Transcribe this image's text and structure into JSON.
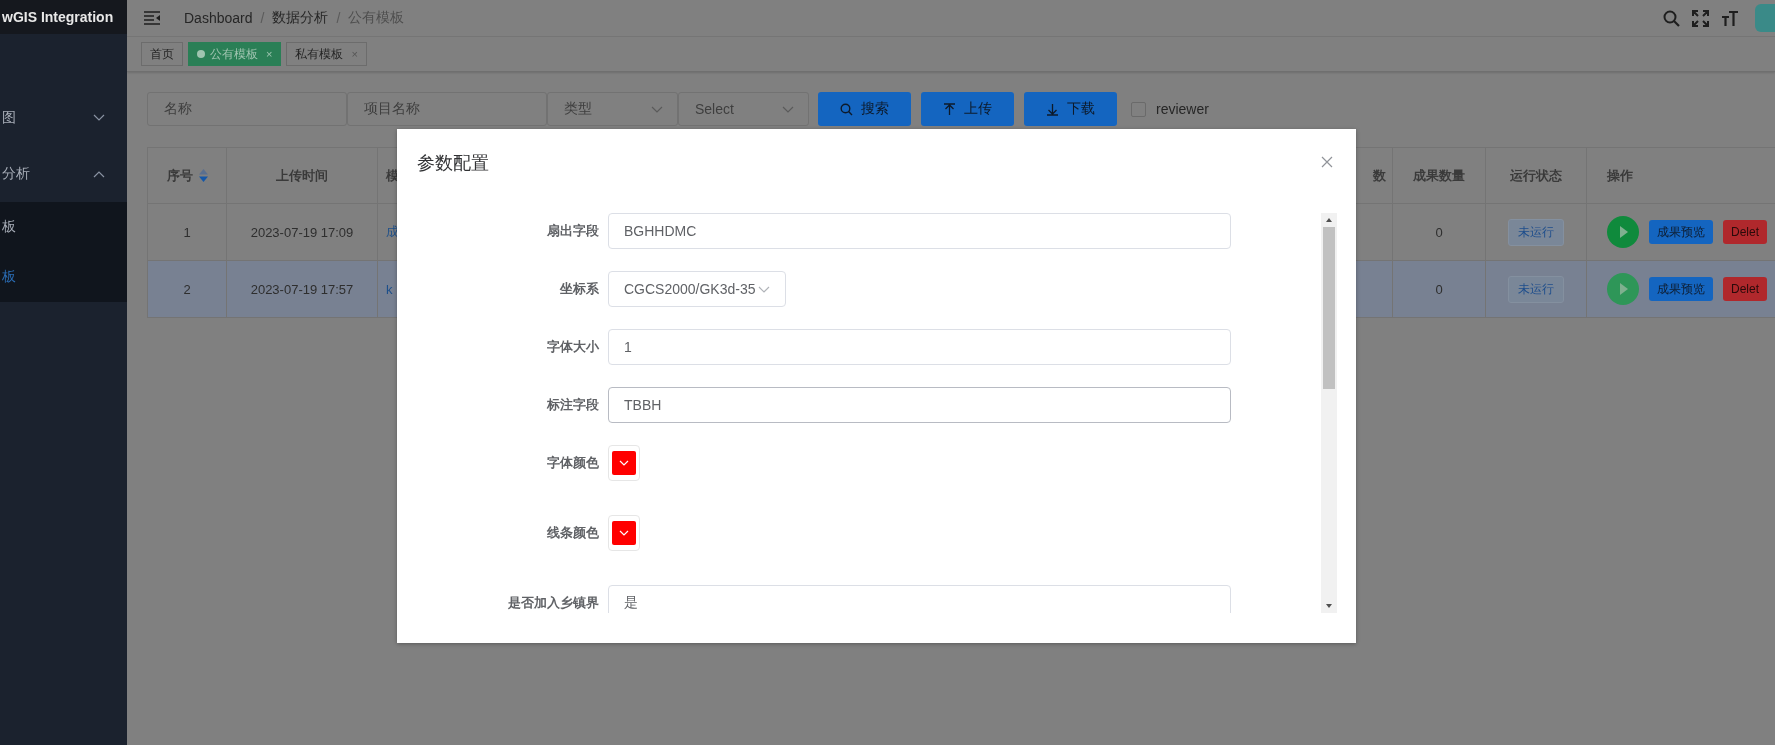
{
  "sidebar": {
    "title": "wGIS Integration",
    "items": [
      {
        "label": "图",
        "expanded": false
      },
      {
        "label": "分析",
        "expanded": true,
        "children": [
          {
            "label": "板",
            "selected": false
          },
          {
            "label": "板",
            "selected": true
          }
        ]
      }
    ]
  },
  "header": {
    "breadcrumb": [
      {
        "label": "Dashboard",
        "current": false
      },
      {
        "label": "数据分析",
        "current": false
      },
      {
        "label": "公有模板",
        "current": true
      }
    ],
    "separator": "/"
  },
  "tags": [
    {
      "label": "首页",
      "selected": false
    },
    {
      "label": "公有模板",
      "selected": true,
      "close": "×"
    },
    {
      "label": "私有模板",
      "selected": false,
      "close": "×"
    }
  ],
  "filters": [
    {
      "kind": "input",
      "placeholder": "名称"
    },
    {
      "kind": "input",
      "placeholder": "项目名称"
    },
    {
      "kind": "select",
      "placeholder": "类型"
    },
    {
      "kind": "select",
      "placeholder": "Select"
    }
  ],
  "buttons": [
    {
      "label": "搜索",
      "kind": "search"
    },
    {
      "label": "上传",
      "kind": "upload"
    },
    {
      "label": "下载",
      "kind": "download"
    }
  ],
  "checkbox": {
    "label": "reviewer",
    "checked": false
  },
  "table": {
    "columns": [
      {
        "label": "序号",
        "sortable": true
      },
      {
        "label": "上传时间"
      },
      {
        "label": "模"
      },
      {
        "label": "数"
      },
      {
        "label": "成果数量"
      },
      {
        "label": "运行状态"
      },
      {
        "label": "操作"
      }
    ],
    "rows": [
      {
        "selected": false,
        "index": "1",
        "time": "2023-07-19 17:09",
        "column_3": "成",
        "count": "0",
        "status": "未运行",
        "preview": "成果预览",
        "delete": "Delet"
      },
      {
        "selected": true,
        "index": "2",
        "time": "2023-07-19 17:57",
        "column_3": "k",
        "count": "0",
        "status": "未运行",
        "preview": "成果预览",
        "delete": "Delet"
      }
    ]
  },
  "dialog": {
    "title": "参数配置",
    "fields": [
      {
        "label": "扇出字段",
        "kind": "input",
        "value": "BGHHDMC",
        "focused": false
      },
      {
        "label": "坐标系",
        "kind": "select",
        "value": "CGCS2000/GK3d-35"
      },
      {
        "label": "字体大小",
        "kind": "input",
        "value": "1",
        "focused": false
      },
      {
        "label": "标注字段",
        "kind": "input",
        "value": "TBBH",
        "focused": true
      },
      {
        "label": "字体颜色",
        "kind": "color",
        "color": "#ff0000"
      },
      {
        "label": "线条颜色",
        "kind": "color",
        "color": "#ff0000"
      },
      {
        "label": "是否加入乡镇界",
        "kind": "input",
        "value": "是",
        "focused": false
      }
    ]
  }
}
